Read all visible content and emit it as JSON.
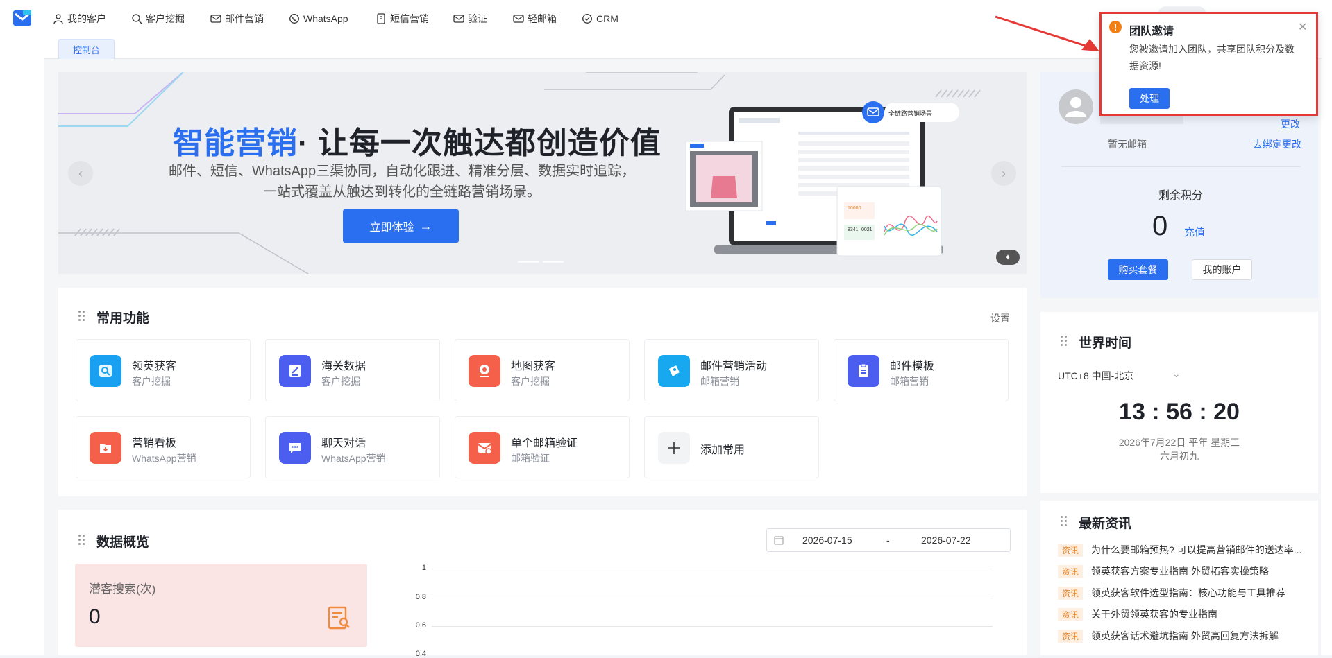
{
  "nav": {
    "items": [
      {
        "label": "我的客户",
        "icon": "user-icon"
      },
      {
        "label": "客户挖掘",
        "icon": "search-icon"
      },
      {
        "label": "邮件营销",
        "icon": "mail-icon"
      },
      {
        "label": "WhatsApp",
        "icon": "whatsapp-icon"
      },
      {
        "label": "短信营销",
        "icon": "sms-icon"
      },
      {
        "label": "验证",
        "icon": "verify-mail-icon"
      },
      {
        "label": "轻邮箱",
        "icon": "light-mail-icon"
      },
      {
        "label": "CRM",
        "icon": "crm-icon"
      }
    ]
  },
  "tabs": {
    "console": "控制台"
  },
  "banner": {
    "title_highlight": "智能营销",
    "title_rest": "· 让每一次触达都创造价值",
    "subtitle": "邮件、短信、WhatsApp三渠协同，自动化跟进、精准分层、数据实时追踪，一站式覆盖从触达到转化的全链路营销场景。",
    "cta": "立即体验",
    "illustration_badge": "全链路营销场景",
    "stat_a": "10000",
    "stat_b": "8341",
    "stat_c": "0021"
  },
  "common_functions": {
    "title": "常用功能",
    "settings": "设置",
    "items": [
      {
        "name": "领英获客",
        "sub": "客户挖掘",
        "icon": "linkedin-search-icon",
        "color": "#1aa0f0"
      },
      {
        "name": "海关数据",
        "sub": "客户挖掘",
        "icon": "customs-data-icon",
        "color": "#4b5ef0"
      },
      {
        "name": "地图获客",
        "sub": "客户挖掘",
        "icon": "map-pin-icon",
        "color": "#f4604a"
      },
      {
        "name": "邮件营销活动",
        "sub": "邮箱营销",
        "icon": "mail-campaign-icon",
        "color": "#18a8ef"
      },
      {
        "name": "邮件模板",
        "sub": "邮箱营销",
        "icon": "mail-template-icon",
        "color": "#4b5ef0"
      },
      {
        "name": "营销看板",
        "sub": "WhatsApp营销",
        "icon": "marketing-board-icon",
        "color": "#f4604a"
      },
      {
        "name": "聊天对话",
        "sub": "WhatsApp营销",
        "icon": "chat-icon",
        "color": "#4b5ef0"
      },
      {
        "name": "单个邮箱验证",
        "sub": "邮箱验证",
        "icon": "mail-verify-icon",
        "color": "#f4604a"
      }
    ],
    "add_label": "添加常用"
  },
  "data_overview": {
    "title": "数据概览",
    "date_start": "2026-07-15",
    "date_sep": "-",
    "date_end": "2026-07-22",
    "stat_label": "潜客搜索(次)",
    "stat_value": "0",
    "chart_ticks": [
      "1",
      "0.8",
      "0.6",
      "0.4"
    ]
  },
  "profile": {
    "change": "更改",
    "no_email": "暂无邮箱",
    "unbind": "去绑定更改",
    "points_label": "剩余积分",
    "points_value": "0",
    "recharge": "充值",
    "buy": "购买套餐",
    "account": "我的账户"
  },
  "world_time": {
    "title": "世界时间",
    "zone": "UTC+8 中国-北京",
    "time": "13 : 56 : 20",
    "date": "2026年7月22日 平年 星期三",
    "lunar": "六月初九"
  },
  "news": {
    "title": "最新资讯",
    "tag": "资讯",
    "items": [
      "为什么要邮箱预热? 可以提高营销邮件的送达率...",
      "领英获客方案专业指南 外贸拓客实操策略",
      "领英获客软件选型指南：核心功能与工具推荐",
      "关于外贸领英获客的专业指南",
      "领英获客话术避坑指南 外贸高回复方法拆解"
    ]
  },
  "popup": {
    "title": "团队邀请",
    "message": "您被邀请加入团队，共享团队积分及数据资源!",
    "action": "处理"
  },
  "colors": {
    "accent": "#2a6ff0",
    "warn": "#f07f16",
    "annotation": "#e53935"
  }
}
